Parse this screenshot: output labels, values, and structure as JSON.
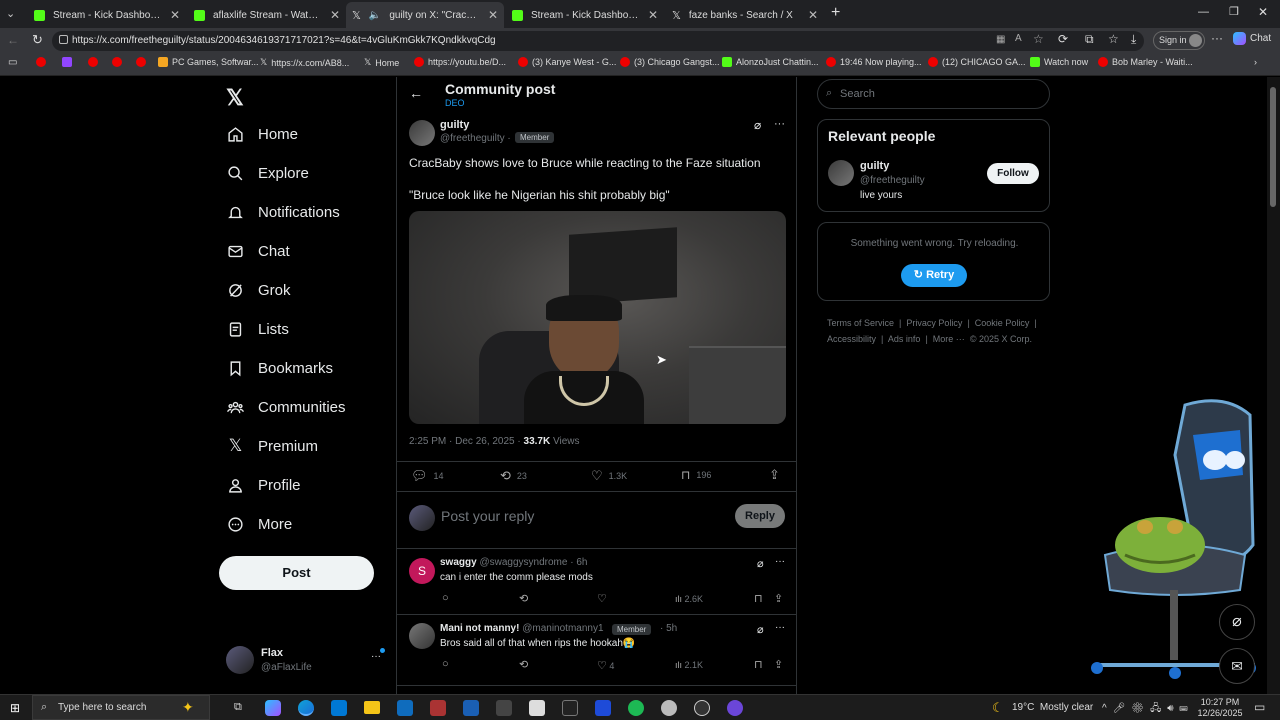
{
  "browser": {
    "tabs": [
      {
        "title": "Stream - Kick Dashboard",
        "color": "#53fc18"
      },
      {
        "title": "aflaxlife Stream - Watch Live on K",
        "color": "#53fc18"
      },
      {
        "title": "guilty on X: \"CracBaby shows",
        "color": "#ffffff"
      },
      {
        "title": "Stream - Kick Dashboard",
        "color": "#53fc18"
      },
      {
        "title": "faze banks - Search / X",
        "color": "#ffffff"
      }
    ],
    "url": "https://x.com/freetheguilty/status/2004634619371717021?s=46&t=4vGluKmGkk7KQndkkvqCdg",
    "signin": "Sign in",
    "chat": "Chat",
    "bookmarks": [
      "PC Games, Softwar...",
      "https://x.com/AB8...",
      "Home",
      "https://youtu.be/D...",
      "(3) Kanye West - G...",
      "(3) Chicago Gangst...",
      "AlonzoJust Chattin...",
      "19:46 Now playing...",
      "(12) CHICAGO GA...",
      "Watch now",
      "Bob Marley - Waiti..."
    ]
  },
  "nav": {
    "items": [
      "Home",
      "Explore",
      "Notifications",
      "Chat",
      "Grok",
      "Lists",
      "Bookmarks",
      "Communities",
      "Premium",
      "Profile",
      "More"
    ],
    "post": "Post",
    "account_name": "Flax",
    "account_handle": "@aFlaxLife"
  },
  "post": {
    "header_title": "Community post",
    "header_sub": "DEO",
    "author": "guilty",
    "handle": "@freetheguilty",
    "badge": "Member",
    "text1": "CracBaby shows love to Bruce while reacting to the Faze situation",
    "text2": "\"Bruce look like he Nigerian his shit probably big\"",
    "time": "2:25 PM · Dec 26, 2025 ·",
    "views": "33.7K",
    "views_label": "Views",
    "replies": "14",
    "reposts": "23",
    "likes": "1.3K",
    "bookmarks": "196",
    "reply_placeholder": "Post your reply",
    "reply_btn": "Reply"
  },
  "replies": [
    {
      "name": "swaggy",
      "handle": "@swaggysyndrome",
      "time": "· 6h",
      "badge": "",
      "text": "can i enter the comm please mods",
      "likes": "",
      "views": "2.6K",
      "avatar": "S"
    },
    {
      "name": "Mani not manny!",
      "handle": "@maninotmanny1",
      "time": "· 5h",
      "badge": "Member",
      "text": "Bros said all of that when rips the hookah😭",
      "likes": "4",
      "views": "2.1K",
      "avatar": ""
    }
  ],
  "right": {
    "search_placeholder": "Search",
    "relevant_title": "Relevant people",
    "person_name": "guilty",
    "person_handle": "@freetheguilty",
    "person_bio": "live yours",
    "follow": "Follow",
    "error": "Something went wrong. Try reloading.",
    "retry": "Retry",
    "footer": [
      "Terms of Service",
      "|",
      "Privacy Policy",
      "|",
      "Cookie Policy",
      "|",
      "Accessibility",
      "|",
      "Ads info",
      "|",
      "More ···",
      "© 2025 X Corp."
    ]
  },
  "taskbar": {
    "search": "Type here to search",
    "weather": "19°C  Mostly clear",
    "time": "10:27 PM",
    "date": "12/26/2025"
  }
}
